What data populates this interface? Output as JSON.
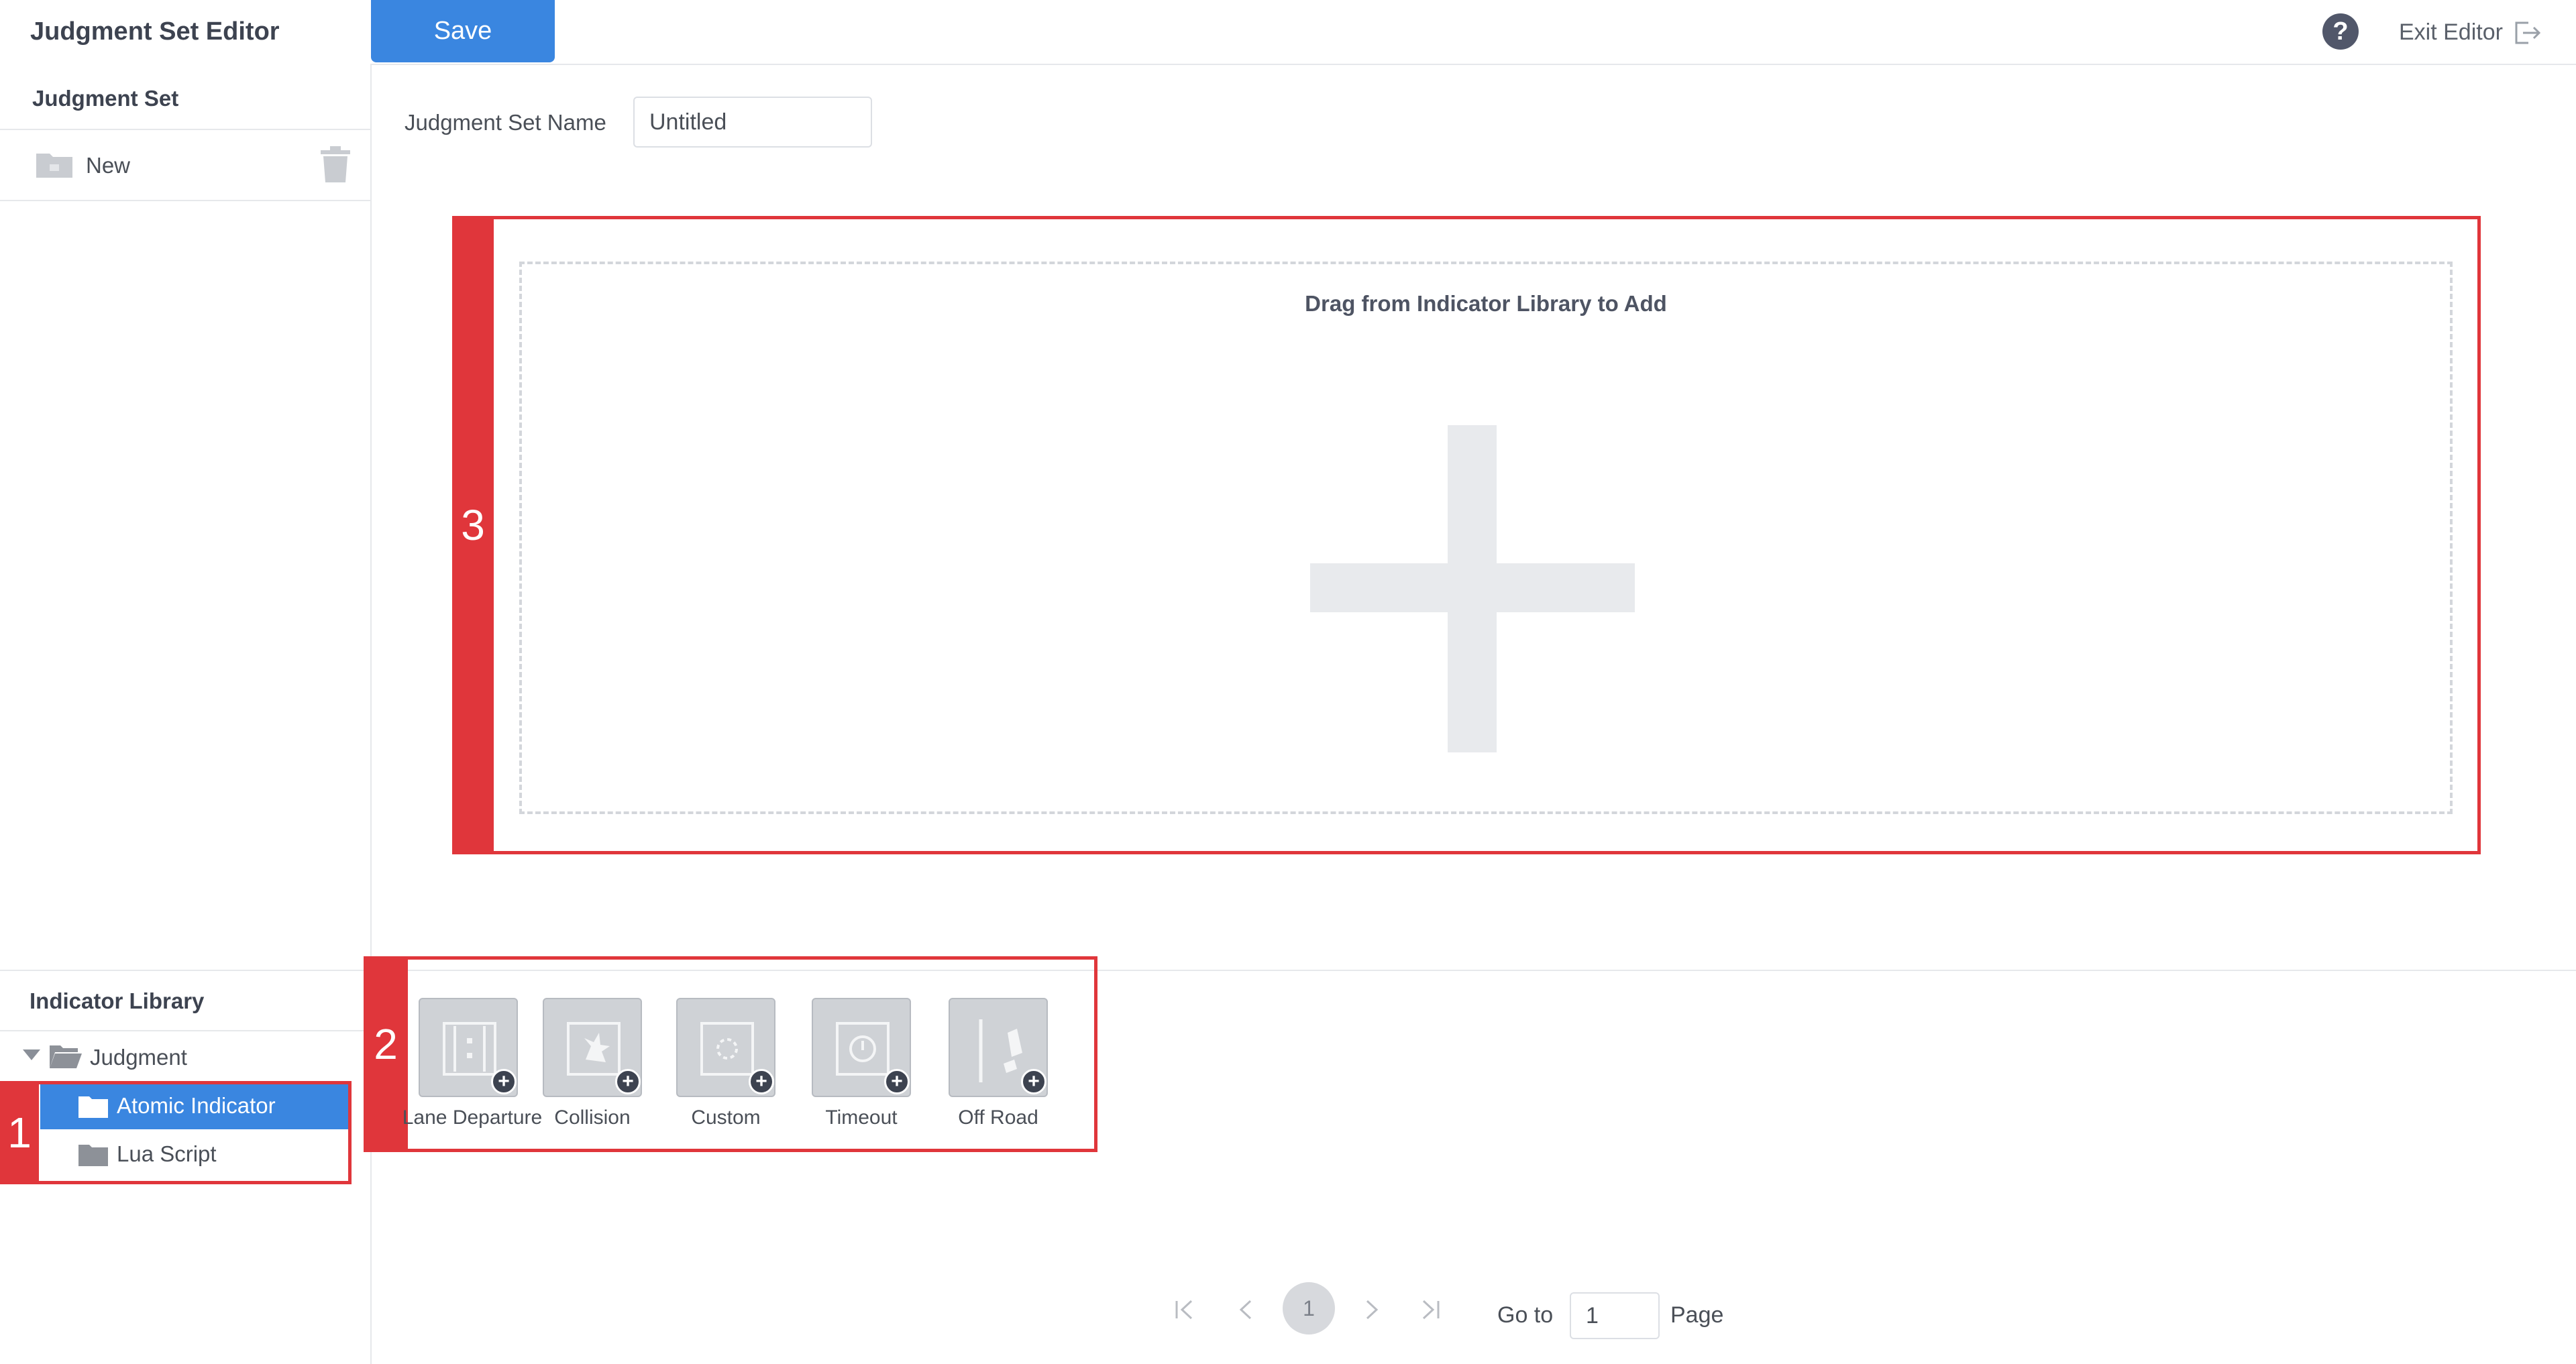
{
  "header": {
    "title": "Judgment Set Editor",
    "save_label": "Save",
    "help_glyph": "?",
    "exit_label": "Exit Editor"
  },
  "sidebar": {
    "judgment_set_header": "Judgment Set",
    "new_label": "New",
    "indicator_library_header": "Indicator Library",
    "tree": {
      "root_label": "Judgment",
      "children": [
        {
          "label": "Atomic Indicator",
          "selected": true
        },
        {
          "label": "Lua Script",
          "selected": false
        }
      ]
    }
  },
  "main": {
    "name_label": "Judgment Set Name",
    "name_value": "Untitled",
    "drop_hint": "Drag from Indicator Library to Add"
  },
  "indicators": [
    {
      "label": "Lane Departure",
      "icon": "lane-departure-icon"
    },
    {
      "label": "Collision",
      "icon": "collision-icon"
    },
    {
      "label": "Custom",
      "icon": "custom-icon"
    },
    {
      "label": "Timeout",
      "icon": "timeout-icon"
    },
    {
      "label": "Off Road",
      "icon": "off-road-icon"
    }
  ],
  "pagination": {
    "current_page": "1",
    "goto_label": "Go to",
    "goto_value": "1",
    "page_label": "Page"
  },
  "annotations": {
    "callout_1": "1",
    "callout_2": "2",
    "callout_3": "3",
    "color": "#e0363b"
  },
  "colors": {
    "accent": "#3a86e0",
    "annotation": "#e0363b"
  }
}
